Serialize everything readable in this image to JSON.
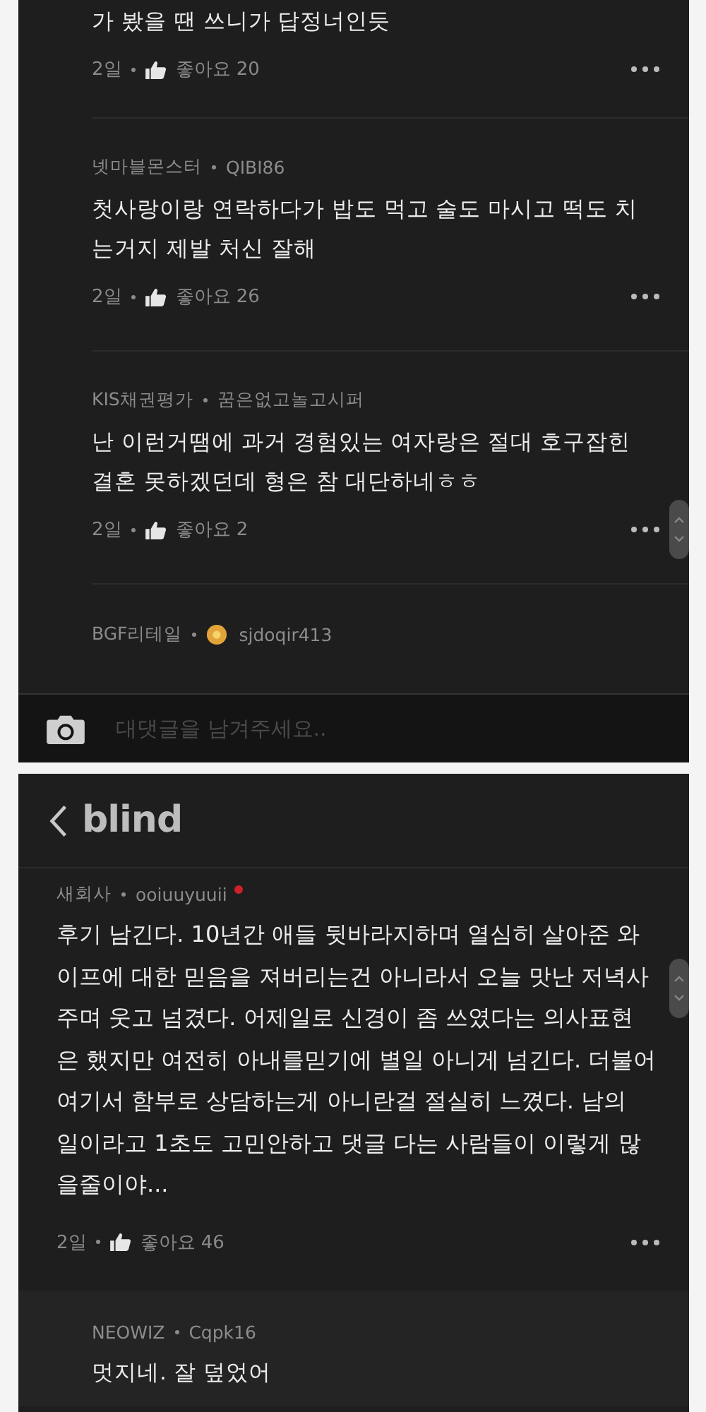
{
  "screens": [
    {
      "comments": [
        {
          "text": "가 봤을 땐 쓰니가 답정너인듯",
          "time": "2일",
          "likes": "좋아요 20"
        },
        {
          "company": "넷마블몬스터",
          "nickname": "QIBI86",
          "coin_badge": false,
          "text": "첫사랑이랑 연락하다가 밥도 먹고 술도 마시고 떡도 치\n는거지 제발 처신 잘해",
          "time": "2일",
          "likes": "좋아요 26"
        },
        {
          "company": "KIS채권평가",
          "nickname": "꿈은없고놀고시퍼",
          "coin_badge": false,
          "text": "난 이런거땜에 과거 경험있는 여자랑은 절대 호구잡힌\n결혼 못하겠던데 형은 참 대단하네ㅎㅎ",
          "time": "2일",
          "likes": "좋아요 2"
        },
        {
          "company": "BGF리테일",
          "nickname": "sjdoqir413",
          "coin_badge": true
        }
      ],
      "reply_input": {
        "placeholder": "대댓글을 남겨주세요.."
      }
    },
    {
      "header": {
        "title": "blind"
      },
      "post": {
        "company": "새회사",
        "nickname": "ooiuuyuuii",
        "new_badge": true,
        "text": "후기 남긴다. 10년간 애들 뒷바라지하며 열심히 살아준 와\n이프에 대한 믿음을 져버리는건 아니라서 오늘 맛난 저녁사\n주며 웃고 넘겼다. 어제일로 신경이 좀 쓰였다는 의사표현\n은 했지만 여전히 아내를믿기에 별일 아니게 넘긴다. 더불어\n여기서 함부로 상담하는게 아니란걸 절실히 느꼈다. 남의\n일이라고 1초도 고민안하고 댓글 다는 사람들이 이렇게 많\n을줄이야...",
        "time": "2일",
        "likes": "좋아요 46"
      },
      "replies": [
        {
          "company": "NEOWIZ",
          "nickname": "Cqpk16",
          "coin_badge": false,
          "text": "멋지네. 잘 덮었어"
        }
      ]
    }
  ]
}
